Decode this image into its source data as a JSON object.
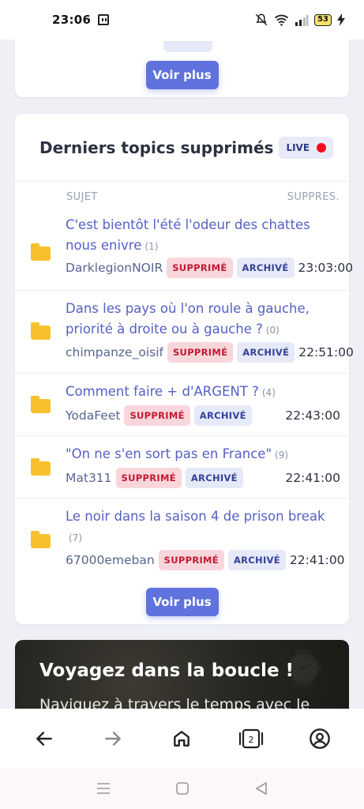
{
  "status_bar": {
    "time": "23:06",
    "battery": "53"
  },
  "top_card": {
    "more_label": "Voir plus"
  },
  "deleted_card": {
    "title_prefix": "Derniers topics",
    "title_bold": "supprimés",
    "live_label": "LIVE",
    "col_subject": "SUJET",
    "col_deleted": "SUPPRES.",
    "more_label": "Voir plus",
    "rows": [
      {
        "title": "C'est bientôt l'été l'odeur des chattes nous enivre",
        "count": "(1)",
        "author": "DarklegionNOIR",
        "tag_deleted": "SUPPRIMÉ",
        "tag_archived": "ARCHIVÉ",
        "time": "23:03:00"
      },
      {
        "title": "Dans les pays où l'on roule à gauche, priorité à droite ou à gauche ?",
        "count": "(0)",
        "author": "chimpanze_oisif",
        "tag_deleted": "SUPPRIMÉ",
        "tag_archived": "ARCHIVÉ",
        "time": "22:51:00"
      },
      {
        "title": "Comment faire + d'ARGENT ?",
        "count": "(4)",
        "author": "YodaFeet",
        "tag_deleted": "SUPPRIMÉ",
        "tag_archived": "ARCHIVÉ",
        "time": "22:43:00"
      },
      {
        "title": "\"On ne s'en sort pas en France\"",
        "count": "(9)",
        "author": "Mat311",
        "tag_deleted": "SUPPRIMÉ",
        "tag_archived": "ARCHIVÉ",
        "time": "22:41:00"
      },
      {
        "title": "Le noir dans la saison 4 de prison break",
        "count": "(7)",
        "author": "67000emeban",
        "tag_deleted": "SUPPRIMÉ",
        "tag_archived": "ARCHIVÉ",
        "time": "22:41:00"
      }
    ]
  },
  "travel_card": {
    "title": "Voyagez dans la boucle !",
    "subtitle": "Naviguez à travers le temps avec le"
  },
  "browser_bar": {
    "tabs_count": "2"
  },
  "colors": {
    "accent": "#5f72dd",
    "link": "#5560c4",
    "deleted_bg": "#f9d6db",
    "archived_bg": "#e6e9f7",
    "live_dot": "#f10d1e",
    "folder": "#f9c02e"
  },
  "icons": [
    "twitch-icon",
    "mute-icon",
    "wifi-icon",
    "signal-icon",
    "battery-icon",
    "charging-icon",
    "folder-icon",
    "back-arrow-icon",
    "forward-arrow-icon",
    "home-icon",
    "tabs-icon",
    "profile-icon",
    "recents-icon",
    "home-square-icon",
    "back-triangle-icon"
  ]
}
